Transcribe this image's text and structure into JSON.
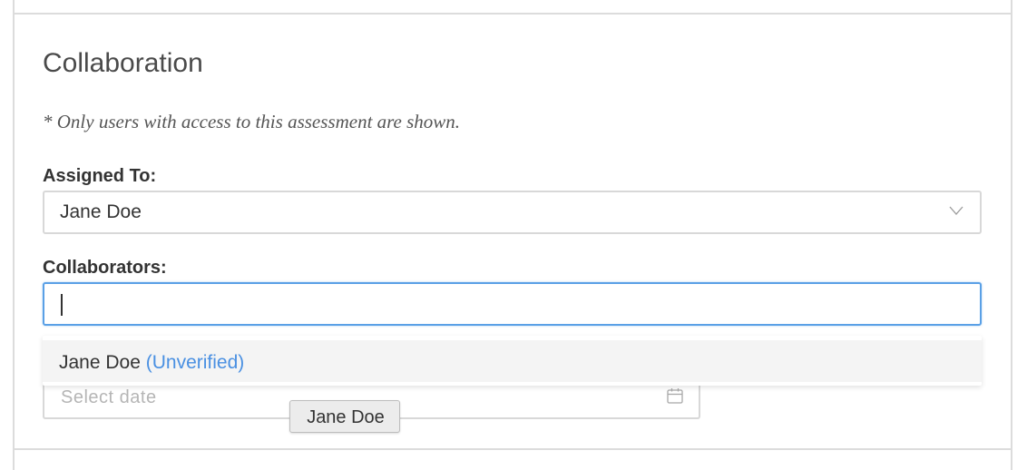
{
  "collaboration": {
    "title": "Collaboration",
    "note": "* Only users with access to this assessment are shown.",
    "assigned_to": {
      "label": "Assigned To:",
      "value": "Jane Doe"
    },
    "collaborators": {
      "label": "Collaborators:",
      "value": ""
    },
    "dropdown": {
      "options": [
        {
          "name": "Jane Doe",
          "status": "(Unverified)"
        }
      ]
    },
    "due_date": {
      "placeholder": "Select date"
    },
    "tooltip": "Jane Doe"
  },
  "colors": {
    "accent": "#4a90e2",
    "focus_border": "#5aa0e6",
    "border": "#d8d8d8"
  },
  "icons": {
    "select_arrow": "chevron-down-icon",
    "date_picker": "calendar-icon"
  }
}
